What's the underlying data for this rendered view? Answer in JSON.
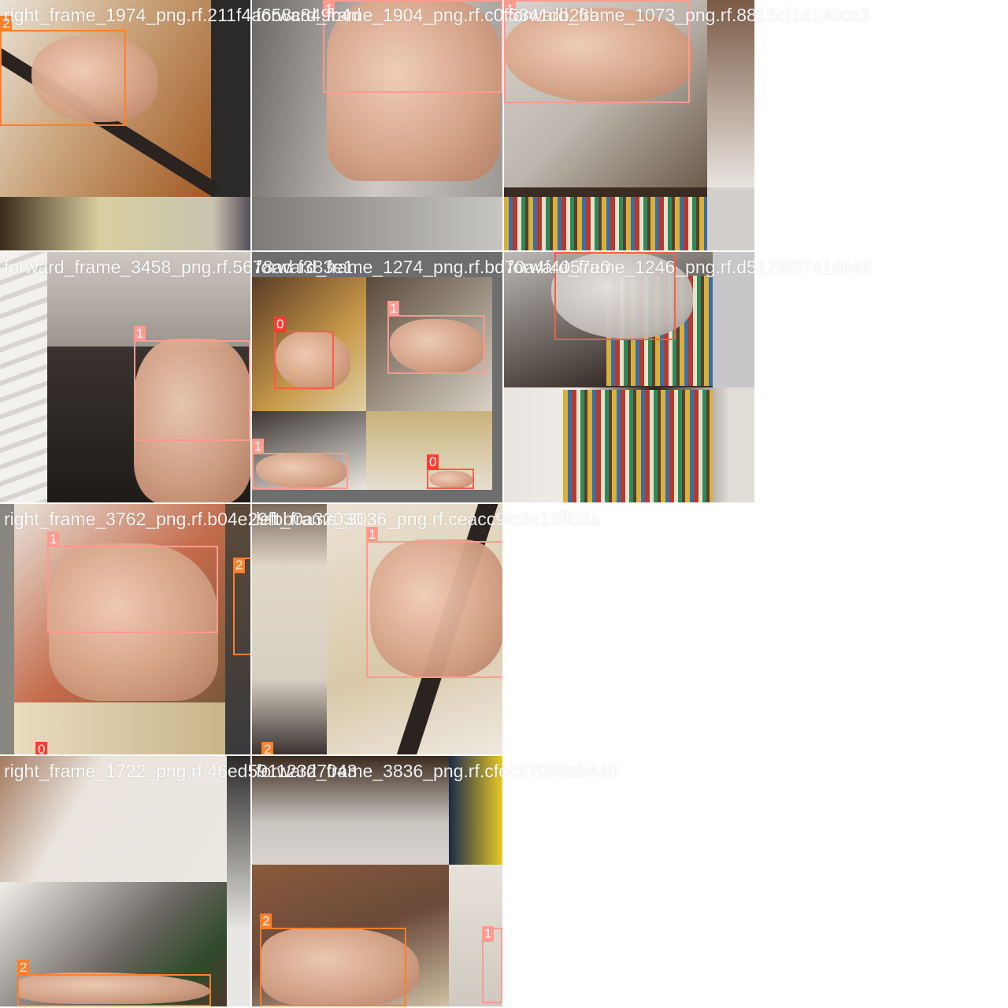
{
  "tiles": [
    {
      "filename": "right_frame_1974_png.rf.211f4a658c849b4d",
      "labels": [
        "2"
      ]
    },
    {
      "filename": "forward_frame_1904_png.rf.c0f5341db26b",
      "labels": [
        "1"
      ]
    },
    {
      "filename": "forward_frame_1073_png.rf.8815cf1d140cc3",
      "labels": [
        "1"
      ]
    },
    {
      "filename": "forward_frame_3458_png.rf.5678ad f383e1",
      "labels": [
        "1"
      ]
    },
    {
      "filename": "forward_frame_1274_png.rf.bd70a4f4057e0",
      "labels": [
        "0",
        "1",
        "1",
        "0"
      ]
    },
    {
      "filename": "forward_frame_1246_png.rf.d517df37e1dc46",
      "labels": [
        "0"
      ]
    },
    {
      "filename": "right_frame_3762_png.rf.b04e29fbb0a32030",
      "labels": [
        "1",
        "2",
        "0"
      ]
    },
    {
      "filename": "left_frame_3036_png.rf.ceacc9fc3e16ff03a",
      "labels": [
        "1",
        "2"
      ]
    },
    {
      "filename": "right_frame_1722_png.rf.46ed59112327043",
      "labels": [
        "2"
      ]
    },
    {
      "filename": "forward_frame_3836_png.rf.cfec67055ab440",
      "labels": [
        "2",
        "1"
      ]
    }
  ],
  "class_colors": {
    "0": "#ff3b30",
    "1": "#ff9a8f",
    "2": "#ff7f2a"
  }
}
